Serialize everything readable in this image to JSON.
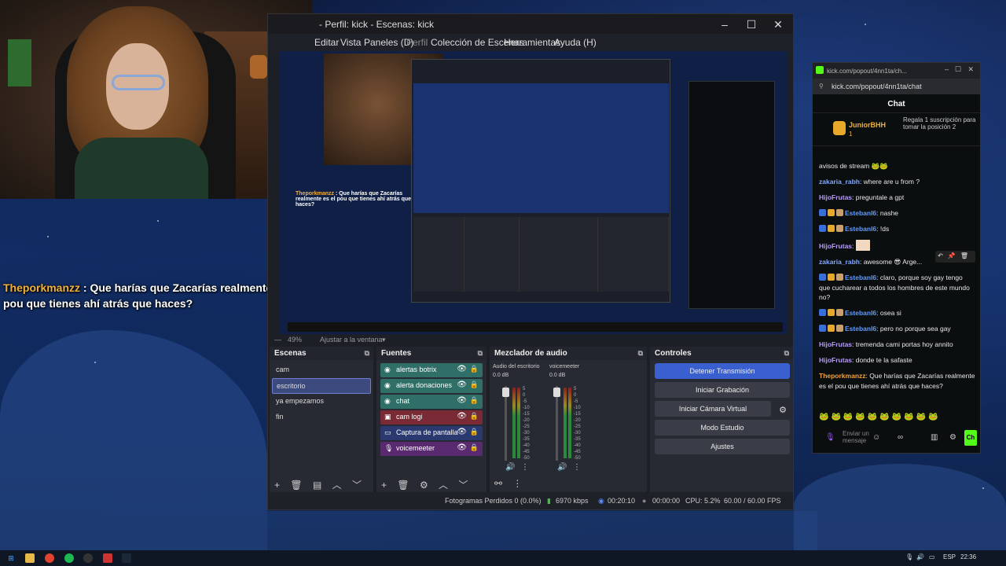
{
  "overlay": {
    "name": "Theporkmanzz",
    "message": " : Que harías que Zacarías realmente es el pou que tienes ahí atrás que haces?"
  },
  "obs": {
    "title": "- Perfil: kick - Escenas: kick",
    "menu": [
      "Editar",
      "Vista",
      "Paneles (D)",
      "Perfil",
      "Colección de Escenas",
      "Herramientas",
      "Ayuda (H)"
    ],
    "zoom": "49%",
    "zoom_fit": "Ajustar a la ventana",
    "docks": {
      "scenes_title": "Escenas",
      "sources_title": "Fuentes",
      "mixer_title": "Mezclador de audio",
      "controls_title": "Controles"
    },
    "scenes": [
      "cam",
      "escritorio",
      "ya empezamos",
      "fin"
    ],
    "selected_scene": "escritorio",
    "sources": [
      {
        "label": "alertas botrix",
        "color": "#2f6f68",
        "icon": "image-icon"
      },
      {
        "label": "alerta donaciones",
        "color": "#2f6f68",
        "icon": "image-icon"
      },
      {
        "label": "chat",
        "color": "#2f6f68",
        "icon": "browser-icon"
      },
      {
        "label": "cam logi",
        "color": "#7a2a34",
        "icon": "camera-icon"
      },
      {
        "label": "Captura de pantalla",
        "color": "#2a3a70",
        "icon": "monitor-icon"
      },
      {
        "label": "voicemeeter",
        "color": "#5a2a70",
        "icon": "mic-icon"
      }
    ],
    "mixer": [
      {
        "name": "Audio del escritorio",
        "db": "0.0 dB"
      },
      {
        "name": "voicemeeter",
        "db": "0.0 dB"
      }
    ],
    "mixer_scale": [
      "5",
      "0",
      "-5",
      "-10",
      "-15",
      "-20",
      "-25",
      "-30",
      "-35",
      "-40",
      "-45",
      "-50",
      "-55",
      "-60"
    ],
    "controls": [
      "Detener Transmisión",
      "Iniciar Grabación",
      "Iniciar Cámara Virtual",
      "Modo Estudio",
      "Ajustes"
    ],
    "status": {
      "frames": "Fotogramas Perdidos 0 (0.0%)",
      "bitrate": "6970 kbps",
      "stream_time": "00:20:10",
      "rec_time": "00:00:00",
      "cpu": "CPU: 5.2%",
      "fps": "60.00 / 60.00 FPS"
    }
  },
  "chatwin": {
    "title": "kick.com/popout/4nn1ta/ch...",
    "url": "kick.com/popout/4nn1ta/chat",
    "header": "Chat",
    "pinned_user": "JuniorBHH",
    "pinned_count": "1",
    "pinned_text": "Regala 1 suscripción para tomar la posición 2",
    "messages": [
      {
        "user": "",
        "text": "avisos de stream",
        "color": "#ffffff",
        "badges": 0
      },
      {
        "user": "zakaria_rabh",
        "text": ": where are u from ?",
        "color": "#7fa7ff",
        "badges": 0
      },
      {
        "user": "HijoFrutas",
        "text": ": preguntale a gpt",
        "color": "#b89aff",
        "badges": 0
      },
      {
        "user": "Estebanl6",
        "text": ": nashe",
        "color": "#5f9cff",
        "badges": 3
      },
      {
        "user": "Estebanl6",
        "text": ": !ds",
        "color": "#5f9cff",
        "badges": 3
      },
      {
        "user": "HijoFrutas",
        "text": ":",
        "color": "#b89aff",
        "badges": 0
      },
      {
        "user": "zakaria_rabh",
        "text": ": awesome 😎 Arge...",
        "color": "#7fa7ff",
        "badges": 0
      },
      {
        "user": "Estebanl6",
        "text": ": claro, porque soy gay tengo que cucharear a todos los hombres de este mundo no?",
        "color": "#5f9cff",
        "badges": 3
      },
      {
        "user": "Estebanl6",
        "text": ": osea si",
        "color": "#5f9cff",
        "badges": 3
      },
      {
        "user": "Estebanl6",
        "text": ": pero no porque sea gay",
        "color": "#5f9cff",
        "badges": 3
      },
      {
        "user": "HijoFrutas",
        "text": ": tremenda cami portas hoy annito",
        "color": "#b89aff",
        "badges": 0
      },
      {
        "user": "HijoFrutas",
        "text": ": donde te la safaste",
        "color": "#b89aff",
        "badges": 0
      },
      {
        "user": "Theporkmanzz",
        "text": ": Que harías que Zacarías realmente es el pou que tienes ahí atrás que haces?",
        "color": "#f2a23a",
        "badges": 0
      }
    ],
    "input_placeholder": "Enviar un mensaje",
    "send_label": "Ch"
  },
  "taskbar": {
    "lang": "ESP",
    "time": "22:36"
  }
}
